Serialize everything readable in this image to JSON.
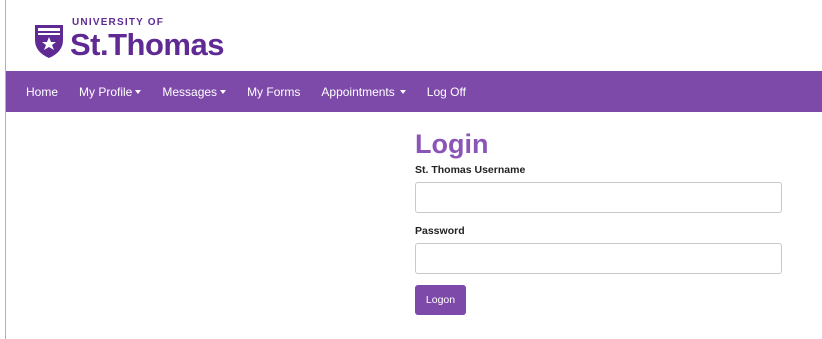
{
  "brand": {
    "top_line": "UNIVERSITY OF",
    "name": "St.Thomas",
    "color": "#5f2a93"
  },
  "nav": {
    "color": "#7d4aa9",
    "items": [
      {
        "label": "Home",
        "dropdown": false
      },
      {
        "label": "My Profile",
        "dropdown": true
      },
      {
        "label": "Messages",
        "dropdown": true
      },
      {
        "label": "My Forms",
        "dropdown": false
      },
      {
        "label": "Appointments",
        "dropdown": true
      },
      {
        "label": "Log Off",
        "dropdown": false
      }
    ]
  },
  "login": {
    "title": "Login",
    "username_label": "St. Thomas Username",
    "username_value": "",
    "password_label": "Password",
    "password_value": "",
    "submit_label": "Logon"
  }
}
